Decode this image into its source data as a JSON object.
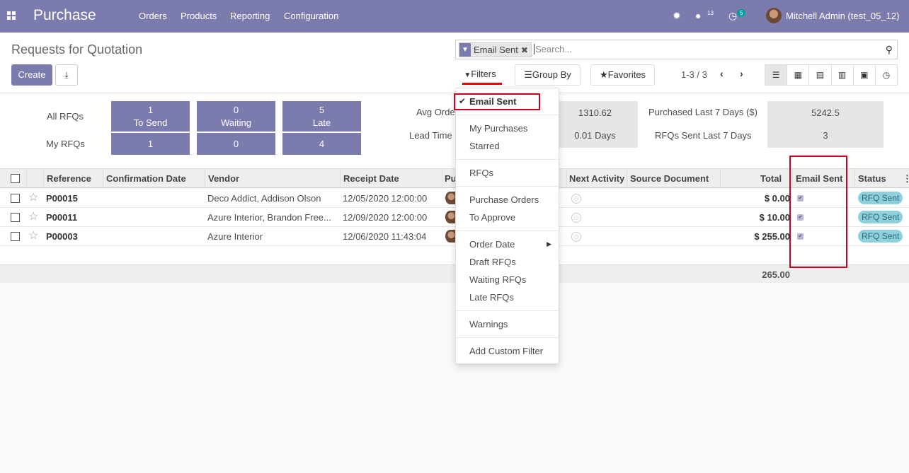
{
  "navbar": {
    "brand": "Purchase",
    "menu": [
      "Orders",
      "Products",
      "Reporting",
      "Configuration"
    ],
    "messages_count": "13",
    "activities_count": "5",
    "user": "Mitchell Admin (test_05_12)"
  },
  "control_panel": {
    "title": "Requests for Quotation",
    "create_label": "Create",
    "facet_label": "Email Sent",
    "search_placeholder": "Search...",
    "filters_label": "Filters",
    "groupby_label": "Group By",
    "favorites_label": "Favorites",
    "pager": "1-3 / 3"
  },
  "dashboard": {
    "all_rfqs_label": "All RFQs",
    "my_rfqs_label": "My RFQs",
    "tiles": [
      {
        "count": "1",
        "label": "To Send",
        "my": "1"
      },
      {
        "count": "0",
        "label": "Waiting",
        "my": "0"
      },
      {
        "count": "5",
        "label": "Late",
        "my": "4"
      }
    ],
    "avg_order_label": "Avg Orde",
    "avg_order_value": "1310.62",
    "lead_time_label": "Lead Time",
    "lead_time_value": "0.01  Days",
    "purchased_label": "Purchased Last 7 Days ($)",
    "purchased_value": "5242.5",
    "rfqs_sent_label": "RFQs Sent Last 7 Days",
    "rfqs_sent_value": "3"
  },
  "table": {
    "columns": {
      "reference": "Reference",
      "confirmation_date": "Confirmation Date",
      "vendor": "Vendor",
      "receipt_date": "Receipt Date",
      "purchase_rep": "Pu",
      "next_activity": "Next Activity",
      "source_document": "Source Document",
      "total": "Total",
      "email_sent": "Email Sent",
      "status": "Status"
    },
    "rows": [
      {
        "reference": "P00015",
        "vendor": "Deco Addict, Addison Olson",
        "receipt_date": "12/05/2020 12:00:00",
        "total": "$ 0.00",
        "status": "RFQ Sent"
      },
      {
        "reference": "P00011",
        "vendor": "Azure Interior, Brandon Free...",
        "receipt_date": "12/09/2020 12:00:00",
        "total": "$ 10.00",
        "status": "RFQ Sent"
      },
      {
        "reference": "P00003",
        "vendor": "Azure Interior",
        "receipt_date": "12/06/2020 11:43:04",
        "total": "$ 255.00",
        "status": "RFQ Sent"
      }
    ],
    "sum_total": "265.00"
  },
  "filters_dropdown": {
    "items": [
      "Email Sent",
      "My Purchases",
      "Starred",
      "RFQs",
      "Purchase Orders",
      "To Approve",
      "Order Date",
      "Draft RFQs",
      "Waiting RFQs",
      "Late RFQs",
      "Warnings",
      "Add Custom Filter"
    ]
  },
  "colors": {
    "brand": "#7c7bad",
    "highlight": "#d0001c",
    "status_badge": "#8ed0dc"
  }
}
